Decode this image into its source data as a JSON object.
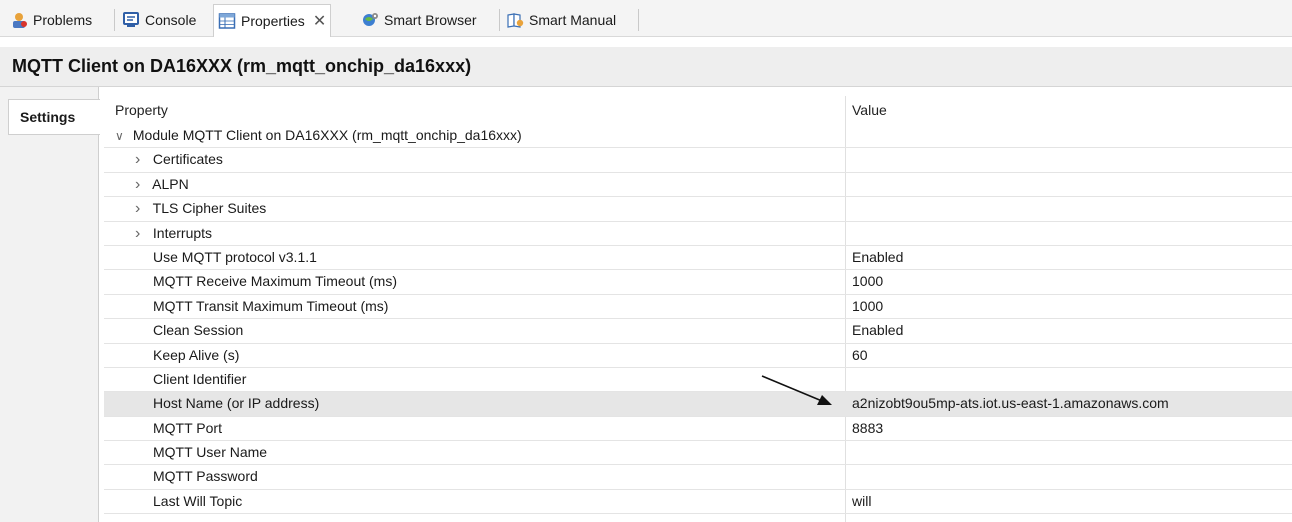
{
  "tabs": [
    {
      "label": "Problems",
      "icon": "problems-icon"
    },
    {
      "label": "Console",
      "icon": "console-icon"
    },
    {
      "label": "Properties",
      "icon": "properties-icon",
      "active": true
    },
    {
      "label": "Smart Browser",
      "icon": "smart-browser-icon"
    },
    {
      "label": "Smart Manual",
      "icon": "smart-manual-icon"
    }
  ],
  "close_glyph": "✕",
  "header": {
    "title": "MQTT Client on DA16XXX (rm_mqtt_onchip_da16xxx)"
  },
  "side": {
    "settings_label": "Settings"
  },
  "table": {
    "col_property": "Property",
    "col_value": "Value",
    "rows": [
      {
        "label": "Module MQTT Client on DA16XXX (rm_mqtt_onchip_da16xxx)",
        "value": "",
        "indent": 0,
        "expander": "expanded"
      },
      {
        "label": "Certificates",
        "value": "",
        "indent": 1,
        "expander": "collapsed"
      },
      {
        "label": "ALPN",
        "value": "",
        "indent": 1,
        "expander": "collapsed"
      },
      {
        "label": "TLS Cipher Suites",
        "value": "",
        "indent": 1,
        "expander": "collapsed"
      },
      {
        "label": "Interrupts",
        "value": "",
        "indent": 1,
        "expander": "collapsed"
      },
      {
        "label": "Use MQTT protocol v3.1.1",
        "value": "Enabled",
        "indent": 1,
        "expander": "none"
      },
      {
        "label": "MQTT Receive Maximum Timeout (ms)",
        "value": "1000",
        "indent": 1,
        "expander": "none"
      },
      {
        "label": "MQTT Transit Maximum Timeout (ms)",
        "value": "1000",
        "indent": 1,
        "expander": "none"
      },
      {
        "label": "Clean Session",
        "value": "Enabled",
        "indent": 1,
        "expander": "none"
      },
      {
        "label": "Keep Alive (s)",
        "value": "60",
        "indent": 1,
        "expander": "none"
      },
      {
        "label": "Client Identifier",
        "value": "",
        "indent": 1,
        "expander": "none"
      },
      {
        "label": "Host Name (or IP address)",
        "value": "a2nizobt9ou5mp-ats.iot.us-east-1.amazonaws.com",
        "indent": 1,
        "expander": "none",
        "selected": true
      },
      {
        "label": "MQTT Port",
        "value": "8883",
        "indent": 1,
        "expander": "none"
      },
      {
        "label": "MQTT User Name",
        "value": "",
        "indent": 1,
        "expander": "none"
      },
      {
        "label": "MQTT Password",
        "value": "",
        "indent": 1,
        "expander": "none"
      },
      {
        "label": "Last Will Topic",
        "value": "will",
        "indent": 1,
        "expander": "none"
      }
    ]
  },
  "colors": {
    "selected_row": "#e6e6e6",
    "header_bg": "#eeeeee",
    "accent": "#2b6cb0"
  }
}
